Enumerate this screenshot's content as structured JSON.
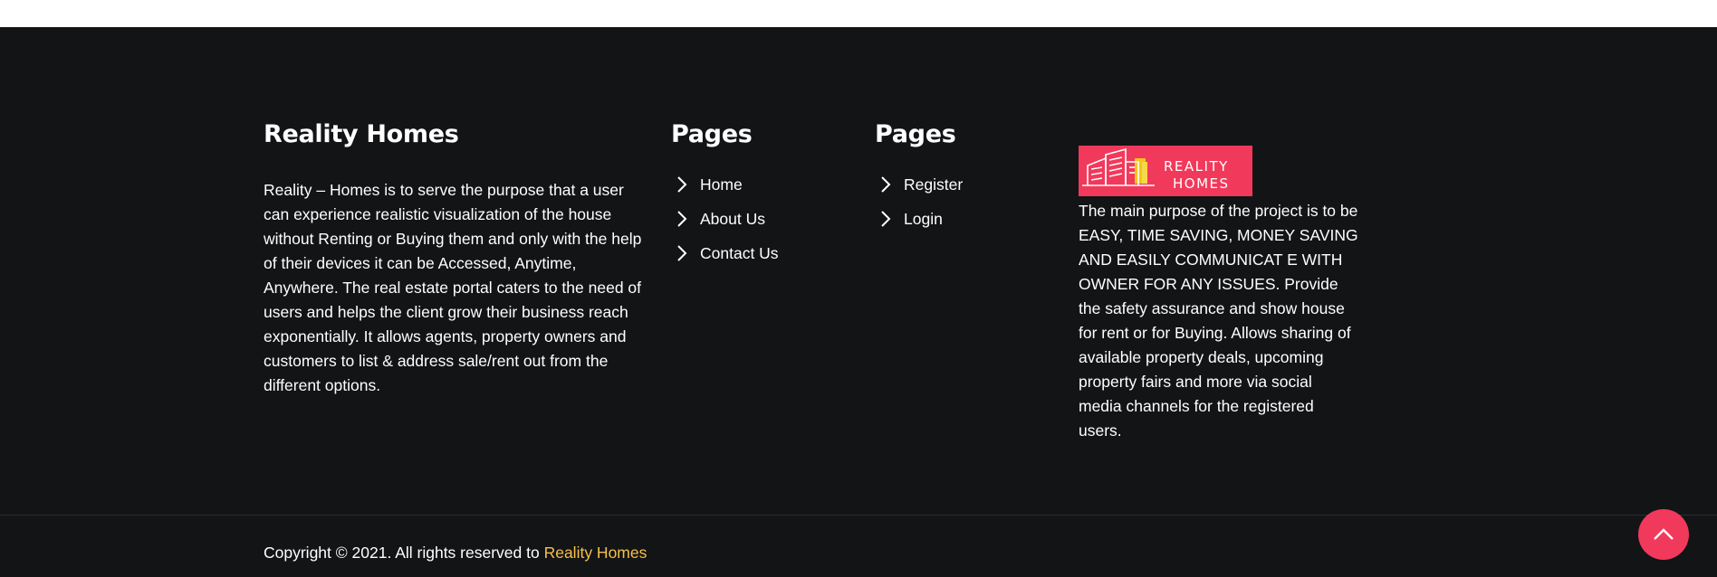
{
  "footer": {
    "about": {
      "title": "Reality Homes",
      "text": "Reality – Homes is to serve the purpose that a user can experience realistic visualization of the house without Renting or Buying them and only with the help of their devices it can be Accessed, Anytime, Anywhere. The real estate portal caters to the need of users and helps the client grow their business reach exponentially. It allows agents, property owners and customers to list & address sale/rent out from the different options."
    },
    "pages_primary": {
      "title": "Pages",
      "links": [
        {
          "label": "Home",
          "icon": "chevron-right-icon"
        },
        {
          "label": "About Us",
          "icon": "chevron-right-icon"
        },
        {
          "label": "Contact Us",
          "icon": "chevron-right-icon"
        }
      ]
    },
    "pages_secondary": {
      "title": "Pages",
      "links": [
        {
          "label": "Register",
          "icon": "chevron-right-icon"
        },
        {
          "label": "Login",
          "icon": "chevron-right-icon"
        }
      ]
    },
    "brand": {
      "logo_line1": "REALITY",
      "logo_line2": "HOMES",
      "logo_color": "#f1395b",
      "text": "The main purpose of the project is to be EASY, TIME SAVING, MONEY SAVING AND EASILY COMMUNICAT E WITH OWNER FOR ANY ISSUES. Provide the safety assurance and show house for rent or for Buying. Allows sharing of available property deals, upcoming property fairs and more via social media channels for the registered users."
    },
    "copyright": {
      "prefix": "Copyright © 2021. All rights reserved to ",
      "link": "Reality Homes",
      "link_color": "#f5c04a"
    },
    "back_to_top": {
      "icon": "chevron-up-icon",
      "color": "#f1395b"
    },
    "background": "#131416"
  }
}
